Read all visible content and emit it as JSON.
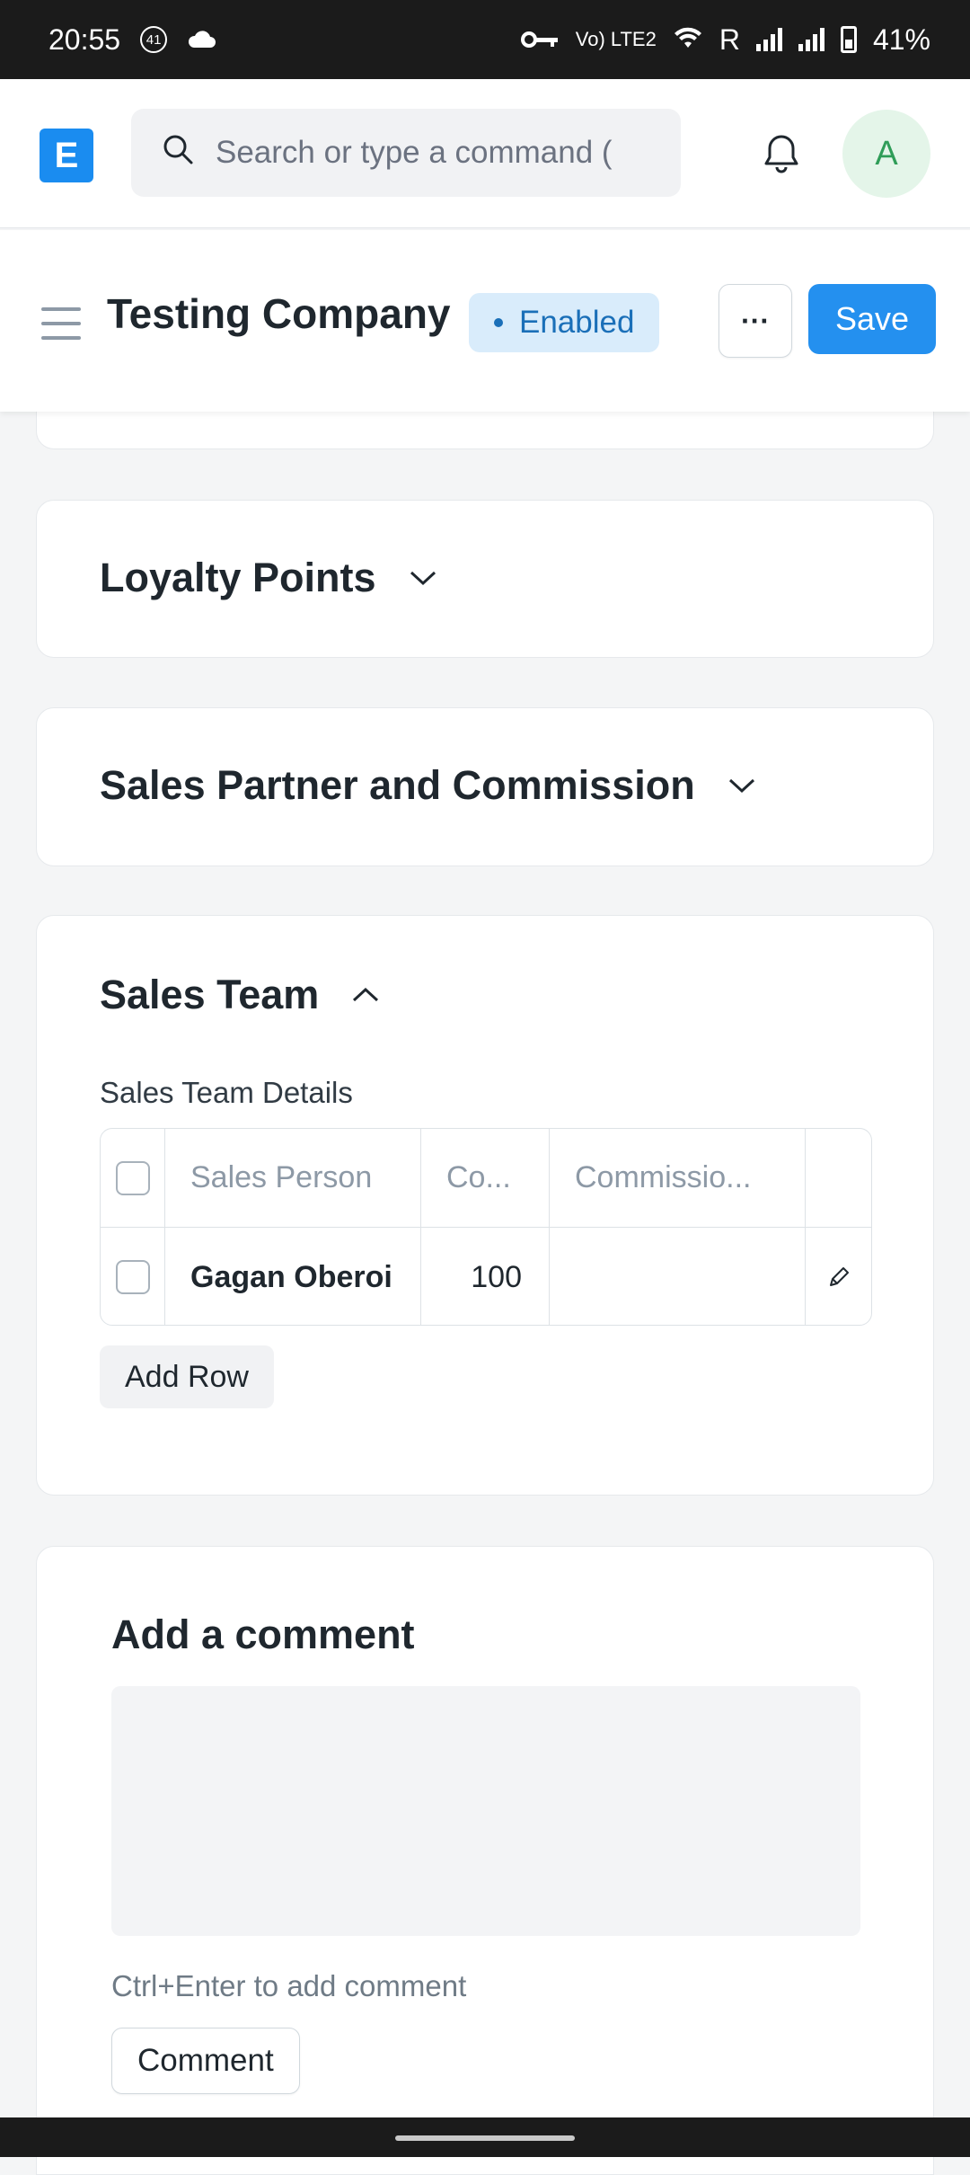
{
  "status_bar": {
    "time": "20:55",
    "notif_count": "41",
    "network_label": "Vo) LTE2",
    "roaming": "R",
    "battery": "41%"
  },
  "navbar": {
    "logo_letter": "E",
    "search_placeholder": "Search or type a command (",
    "avatar_letter": "A"
  },
  "header": {
    "title": "Testing Company",
    "status_badge": "Enabled",
    "more_label": "···",
    "save_label": "Save"
  },
  "sections": {
    "loyalty": {
      "title": "Loyalty Points",
      "expanded": false
    },
    "partner": {
      "title": "Sales Partner and Commission",
      "expanded": false
    },
    "team": {
      "title": "Sales Team",
      "expanded": true,
      "grid_label": "Sales Team Details",
      "columns": [
        "Sales Person",
        "Co...",
        "Commissio..."
      ],
      "rows": [
        {
          "sales_person": "Gagan Oberoi",
          "contribution": "100",
          "commission": ""
        }
      ],
      "add_row_label": "Add Row"
    }
  },
  "comment": {
    "title": "Add a comment",
    "hint": "Ctrl+Enter to add comment",
    "button_label": "Comment"
  },
  "colors": {
    "primary": "#2490ef",
    "badge_bg": "#d9ecfb",
    "badge_text": "#1a6fb8",
    "avatar_bg": "#e4f5e9",
    "avatar_text": "#2f9d58"
  }
}
